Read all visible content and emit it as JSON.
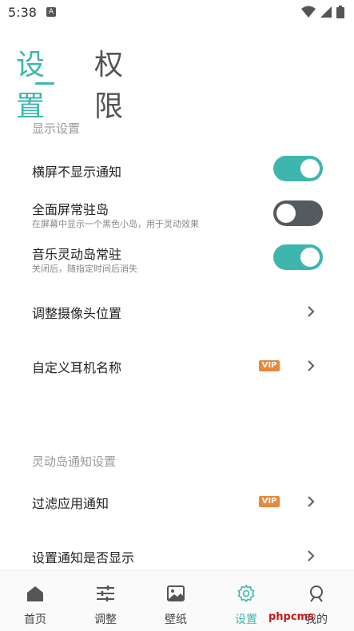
{
  "status_bar": {
    "time": "5:38",
    "notification_letter": "A"
  },
  "tabs": {
    "active": "设置",
    "inactive": "权限"
  },
  "sections": [
    {
      "title": "显示设置",
      "items": [
        {
          "label": "横屏不显示通知",
          "toggle": "on"
        },
        {
          "label": "全面屏常驻岛",
          "sub": "在屏幕中显示一个黑色小岛，用于灵动效果",
          "toggle": "off"
        },
        {
          "label": "音乐灵动岛常驻",
          "sub": "关闭后，随指定时间后消失",
          "toggle": "on"
        },
        {
          "label": "调整摄像头位置"
        },
        {
          "label": "自定义耳机名称",
          "badge": "VIP"
        }
      ]
    },
    {
      "title": "灵动岛通知设置",
      "items": [
        {
          "label": "过滤应用通知",
          "badge": "VIP"
        },
        {
          "label": "设置通知是否显示"
        }
      ]
    }
  ],
  "bottom_nav": [
    {
      "label": "首页",
      "icon": "home-icon"
    },
    {
      "label": "调整",
      "icon": "sliders-icon"
    },
    {
      "label": "壁纸",
      "icon": "wallpaper-icon"
    },
    {
      "label": "设置",
      "icon": "settings-gear-icon",
      "active": true
    },
    {
      "label": "我的",
      "icon": "profile-icon"
    }
  ],
  "watermark": "phpcms",
  "colors": {
    "accent": "#3fb6ad",
    "toggle_off": "#555a5e",
    "vip": "#e9873a"
  }
}
